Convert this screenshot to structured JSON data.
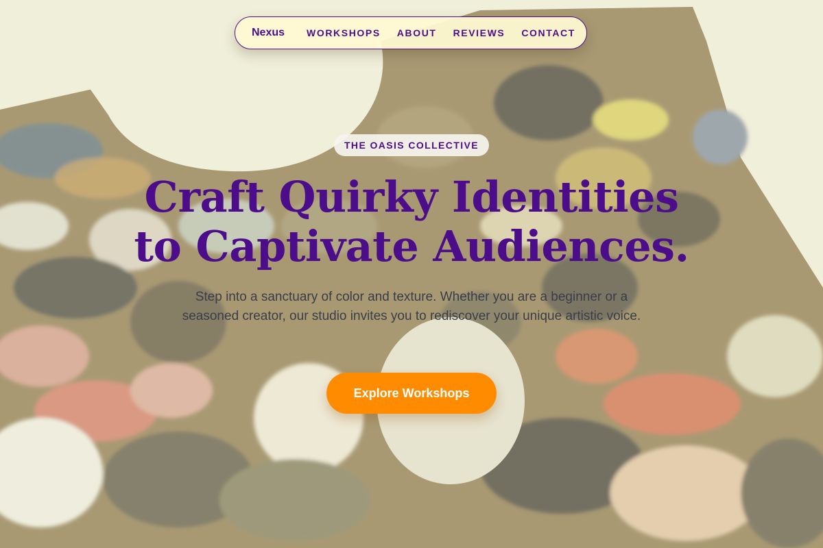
{
  "nav": {
    "brand": "Nexus",
    "links": [
      "WORKSHOPS",
      "ABOUT",
      "REVIEWS",
      "CONTACT"
    ]
  },
  "hero": {
    "eyebrow": "THE OASIS COLLECTIVE",
    "headline_line1": "Craft Quirky Identities",
    "headline_line2": "to Captivate Audiences.",
    "description": "Step into a sanctuary of color and texture. Whether you are a beginner or a seasoned creator, our studio invites you to rediscover your unique artistic voice.",
    "cta_label": "Explore Workshops",
    "background_image": "paint-palette-photo"
  },
  "colors": {
    "primary_purple": "#4b0d8a",
    "cta_orange": "#ff8c00",
    "nav_bg": "#fffad2",
    "body_text": "#3a3d48"
  }
}
